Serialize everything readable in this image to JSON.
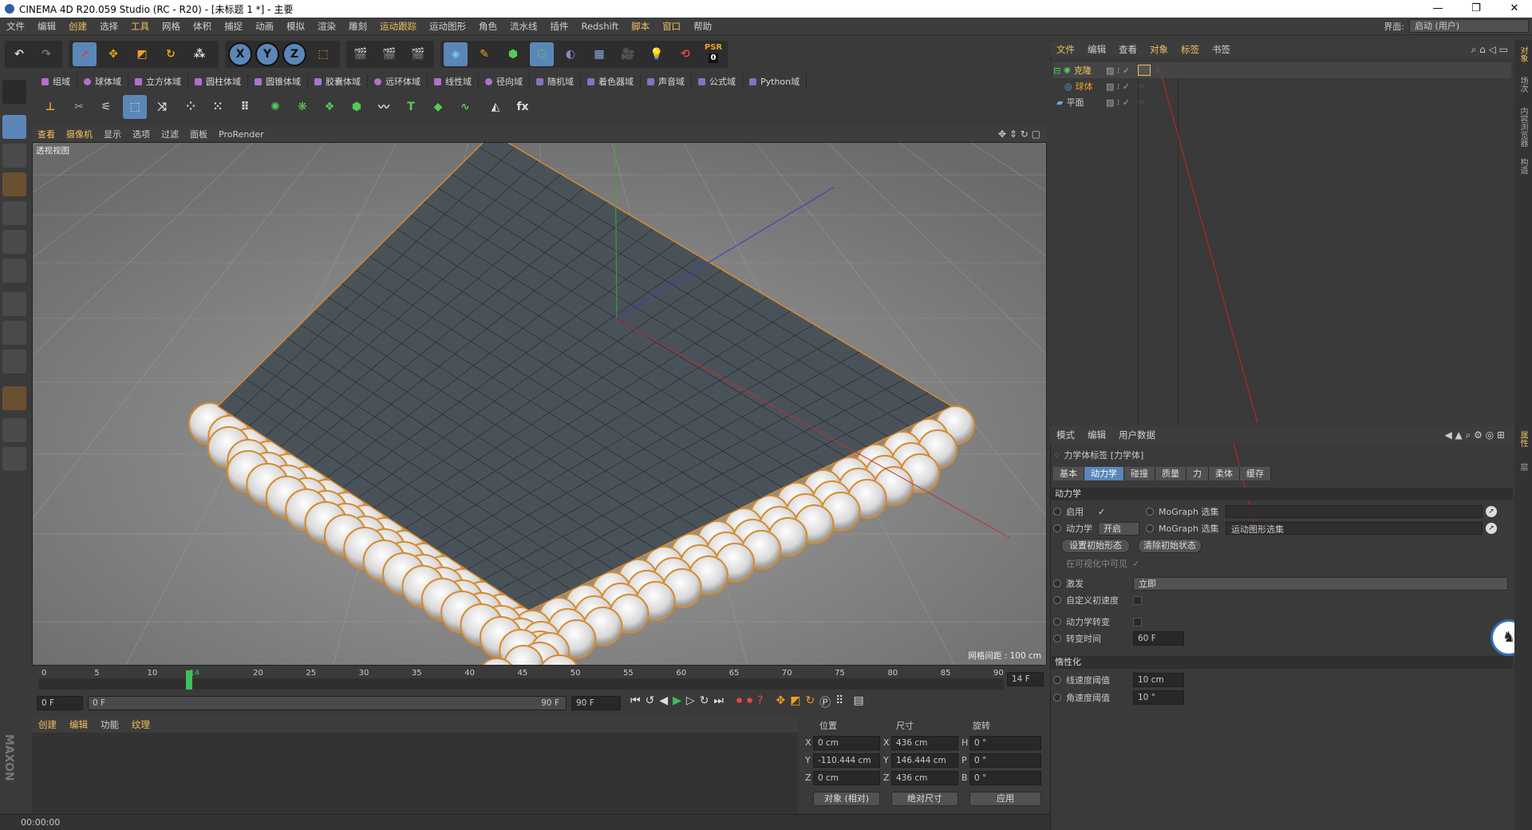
{
  "window": {
    "title": "CINEMA 4D R20.059 Studio (RC - R20) - [未标题 1 *] - 主要",
    "min": "—",
    "max": "❐",
    "close": "✕"
  },
  "menu": [
    "文件",
    "编辑",
    "创建",
    "选择",
    "工具",
    "网格",
    "体积",
    "捕捉",
    "动画",
    "模拟",
    "渲染",
    "雕刻",
    "运动跟踪",
    "运动图形",
    "角色",
    "流水线",
    "插件",
    "Redshift",
    "脚本",
    "窗口",
    "帮助"
  ],
  "interface": {
    "label": "界面:",
    "value": "启动 (用户)"
  },
  "toolbar": {
    "x": "X",
    "y": "Y",
    "z": "Z",
    "psr": "PSR",
    "psr_value": "0"
  },
  "fields": [
    "组域",
    "球体域",
    "立方体域",
    "圆柱体域",
    "圆锥体域",
    "胶囊体域",
    "远环体域",
    "线性域",
    "径向域",
    "随机域",
    "着色器域",
    "声音域",
    "公式域",
    "Python域"
  ],
  "viewport": {
    "menu": [
      "查看",
      "摄像机",
      "显示",
      "选项",
      "过滤",
      "面板",
      "ProRender"
    ],
    "label": "透视视图",
    "grid_info": "网格间距 : 100 cm"
  },
  "timeline": {
    "ticks": [
      "0",
      "5",
      "10",
      "14",
      "20",
      "25",
      "30",
      "35",
      "40",
      "45",
      "50",
      "55",
      "60",
      "65",
      "70",
      "75",
      "80",
      "85",
      "90"
    ],
    "current_frame": "14 F",
    "start": "0 F",
    "range_start": "0 F",
    "range_end": "90 F",
    "end": "90 F"
  },
  "material": {
    "menu": [
      "创建",
      "编辑",
      "功能",
      "纹理"
    ]
  },
  "coords": {
    "headers": [
      "位置",
      "尺寸",
      "旋转"
    ],
    "rows": [
      {
        "axis": "X",
        "pos": "0 cm",
        "size_axis": "X",
        "size": "436 cm",
        "rot_axis": "H",
        "rot": "0 °"
      },
      {
        "axis": "Y",
        "pos": "-110.444 cm",
        "size_axis": "Y",
        "size": "146.444 cm",
        "rot_axis": "P",
        "rot": "0 °"
      },
      {
        "axis": "Z",
        "pos": "0 cm",
        "size_axis": "Z",
        "size": "436 cm",
        "rot_axis": "B",
        "rot": "0 °"
      }
    ],
    "mode": "对象 (相对)",
    "size_mode": "绝对尺寸",
    "apply": "应用"
  },
  "status": {
    "time": "00:00:00"
  },
  "objects": {
    "menu": [
      "文件",
      "编辑",
      "查看",
      "对象",
      "标签",
      "书签"
    ],
    "items": [
      {
        "name": "克隆",
        "color": "#f0c060"
      },
      {
        "name": "球体",
        "color": "#f0a020"
      },
      {
        "name": "平面",
        "color": "#d0d0d0"
      }
    ]
  },
  "attributes": {
    "menu": [
      "模式",
      "编辑",
      "用户数据"
    ],
    "title": "力学体标签 [力学体]",
    "tabs": [
      "基本",
      "动力学",
      "碰撞",
      "质量",
      "力",
      "柔体",
      "缓存"
    ],
    "section_dynamics": "动力学",
    "enable_label": "启用",
    "mograph_sel_label": "MoGraph 选集",
    "dynamic_label": "动力学",
    "dynamic_value": "开启",
    "mograph_sel_label2": "MoGraph 选集",
    "mograph_sel_value": "运动图形选集",
    "set_initial": "设置初始形态",
    "clear_initial": "清除初始状态",
    "visible_in_viewport": "在可视化中可见",
    "trigger_label": "激发",
    "trigger_value": "立即",
    "custom_velocity": "自定义初速度",
    "dyn_transition": "动力学转变",
    "transition_time_label": "转变时间",
    "transition_time": "60 F",
    "section_inertia": "惰性化",
    "linear_thresh_label": "线速度阈值",
    "linear_thresh": "10 cm",
    "angular_thresh_label": "角速度阈值",
    "angular_thresh": "10 °"
  },
  "side_tabs": [
    "对象",
    "场次",
    "内容浏览器",
    "构造",
    "属性",
    "层"
  ],
  "colors": {
    "accent": "#5a87b8",
    "highlight": "#f0c060",
    "plane": "#4a5259",
    "sphere_edge": "#d88a2a"
  }
}
